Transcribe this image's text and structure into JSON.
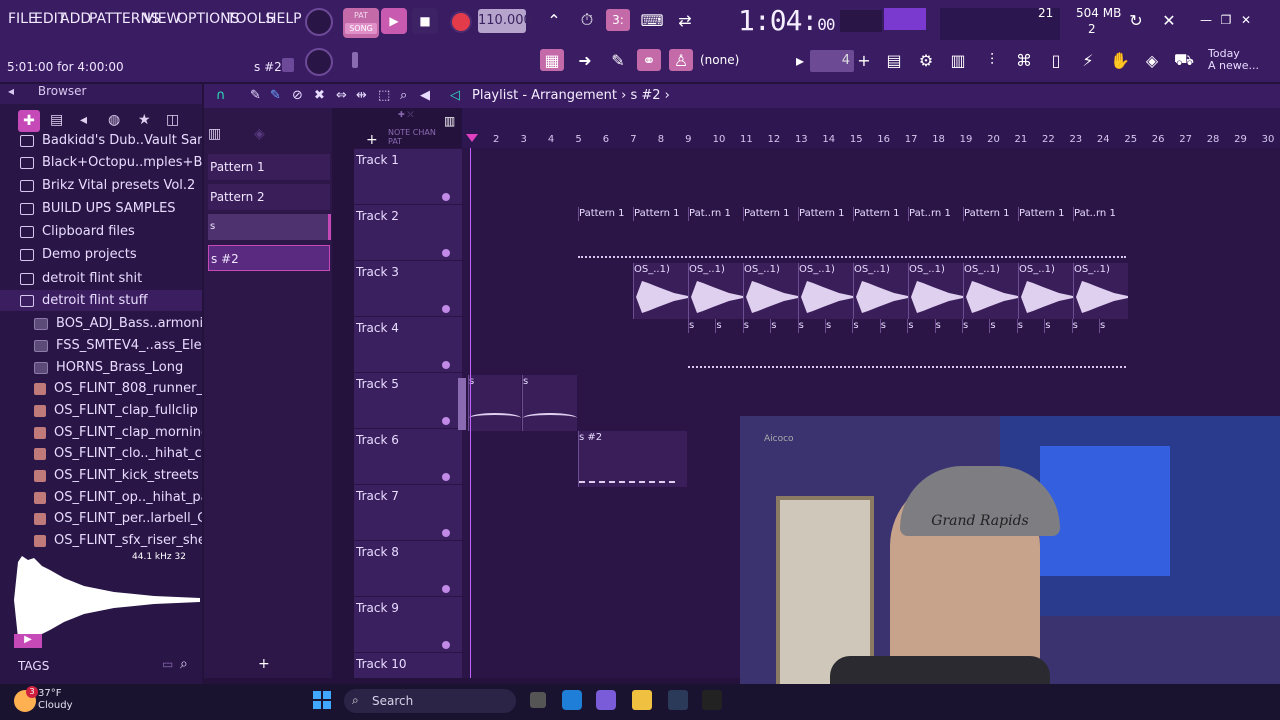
{
  "menu": [
    "FILE",
    "EDIT",
    "ADD",
    "PATTERNS",
    "VIEW",
    "OPTIONS",
    "TOOLS",
    "HELP"
  ],
  "hint": "5:01:00 for 4:00:00",
  "pattern_label": "s #2",
  "transport": {
    "mode_pat": "PAT",
    "mode_song": "SONG",
    "tempo": "110.000",
    "time_main": "1:04:",
    "time_small": "00",
    "bst": "B:S:T",
    "mem": "504 MB",
    "cpu": "21",
    "poly": "2"
  },
  "toolbar2": {
    "pattern_select": "(none)",
    "snap": "4",
    "news_title": "Today",
    "news_text": "A newe..."
  },
  "browser": {
    "title": "Browser",
    "items": [
      {
        "label": "Badkidd's Dub..Vault Samples",
        "type": "folder"
      },
      {
        "label": "Black+Octopu..mples+Bundle",
        "type": "folder"
      },
      {
        "label": "Brikz Vital presets Vol.2",
        "type": "folder"
      },
      {
        "label": "BUILD UPS SAMPLES",
        "type": "folder"
      },
      {
        "label": "Clipboard files",
        "type": "folder"
      },
      {
        "label": "Demo projects",
        "type": "folder"
      },
      {
        "label": "detroit flint shit",
        "type": "folder"
      },
      {
        "label": "detroit flint stuff",
        "type": "folder"
      },
      {
        "label": "BOS_ADJ_Bass..armonica (1)",
        "type": "vst"
      },
      {
        "label": "FSS_SMTEV4_..ass_Elephant",
        "type": "vst"
      },
      {
        "label": "HORNS_Brass_Long",
        "type": "vst"
      },
      {
        "label": "OS_FLINT_808_runner_C",
        "type": "file"
      },
      {
        "label": "OS_FLINT_clap_fullclip",
        "type": "file"
      },
      {
        "label": "OS_FLINT_clap_morning",
        "type": "file"
      },
      {
        "label": "OS_FLINT_clo.._hihat_clone",
        "type": "file"
      },
      {
        "label": "OS_FLINT_kick_streets (1)",
        "type": "file"
      },
      {
        "label": "OS_FLINT_op.._hihat_panic",
        "type": "file"
      },
      {
        "label": "OS_FLINT_per..larbell_C (1)",
        "type": "file"
      },
      {
        "label": "OS_FLINT_sfx_riser_shenk",
        "type": "file"
      }
    ],
    "sample_info": "44.1 kHz 32",
    "tags": "TAGS"
  },
  "patterns": [
    "Pattern 1",
    "Pattern 2",
    "s",
    "s #2"
  ],
  "playlist": {
    "title": "Playlist - Arrangement",
    "arrow": "›",
    "pattern": "s #2",
    "ruler": [
      "2",
      "3",
      "4",
      "5",
      "6",
      "7",
      "8",
      "9",
      "10",
      "11",
      "12",
      "13",
      "14",
      "15",
      "16",
      "17",
      "18",
      "19",
      "20",
      "21",
      "22",
      "23",
      "24",
      "25",
      "26",
      "27",
      "28",
      "29",
      "30"
    ],
    "tracks": [
      "Track 1",
      "Track 2",
      "Track 3",
      "Track 4",
      "Track 5",
      "Track 6",
      "Track 7",
      "Track 8",
      "Track 9",
      "Track 10"
    ],
    "track2_clips": [
      "Pattern 1",
      "Pattern 1",
      "Pat..rn 1",
      "Pattern 1",
      "Pattern 1",
      "Pattern 1",
      "Pat..rn 1",
      "Pattern 1",
      "Pattern 1",
      "Pat..rn 1"
    ],
    "track3_clip": "OS_..1)",
    "track4_clip": "s",
    "track5_clips": [
      "s",
      "s"
    ],
    "track6_clip": "s #2"
  },
  "webcam": {
    "logo": "Aicoco",
    "beanie": "Grand Rapids"
  },
  "taskbar": {
    "temp": "37°F",
    "cond": "Cloudy",
    "search": "Search",
    "badge": "3"
  }
}
